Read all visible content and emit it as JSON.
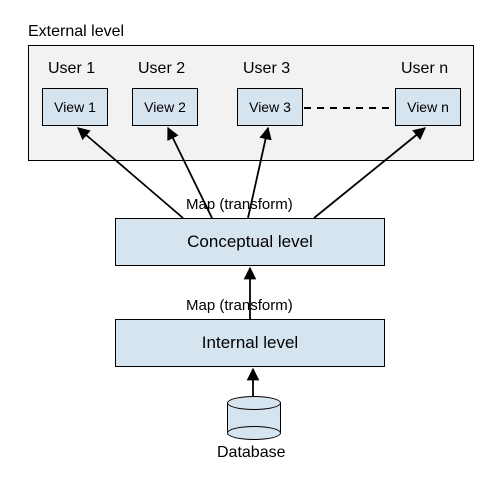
{
  "labels": {
    "external": "External level",
    "mapping1": "Map (transform)",
    "conceptual": "Conceptual level",
    "mapping2": "Map (transform)",
    "internal": "Internal level",
    "db": "Database"
  },
  "users": [
    {
      "user": "User 1",
      "view": "View 1"
    },
    {
      "user": "User 2",
      "view": "View 2"
    },
    {
      "user": "User 3",
      "view": "View 3"
    },
    {
      "user": "User n",
      "view": "View n"
    }
  ],
  "colors": {
    "box_fill": "#d6e4f0",
    "ext_fill": "#f2f2f2",
    "border": "#000000"
  }
}
